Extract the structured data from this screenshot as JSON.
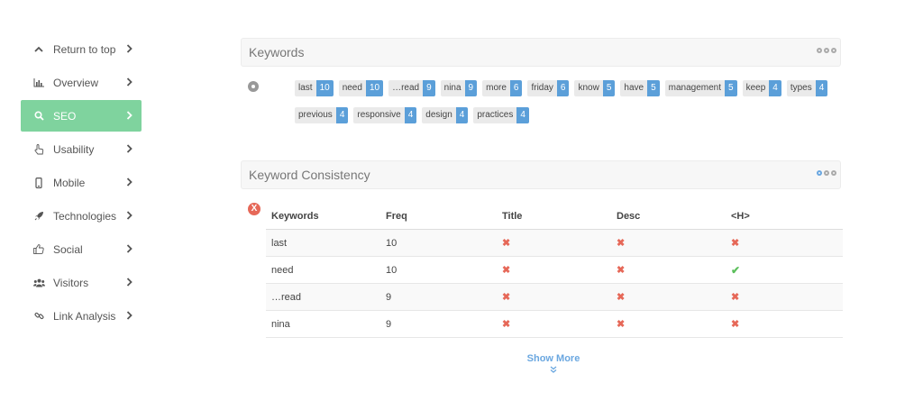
{
  "sidebar": {
    "items": [
      {
        "label": "Return to top",
        "icon": "chevron-up-icon"
      },
      {
        "label": "Overview",
        "icon": "bar-chart-icon"
      },
      {
        "label": "SEO",
        "icon": "search-icon",
        "active": true
      },
      {
        "label": "Usability",
        "icon": "pointer-hand-icon"
      },
      {
        "label": "Mobile",
        "icon": "mobile-icon"
      },
      {
        "label": "Technologies",
        "icon": "rocket-icon"
      },
      {
        "label": "Social",
        "icon": "thumbs-up-icon"
      },
      {
        "label": "Visitors",
        "icon": "users-icon"
      },
      {
        "label": "Link Analysis",
        "icon": "link-icon"
      }
    ],
    "active_color": "#7fd39e"
  },
  "keywords": {
    "title": "Keywords",
    "tags": [
      {
        "word": "last",
        "count": "10"
      },
      {
        "word": "need",
        "count": "10"
      },
      {
        "word": "…read",
        "count": "9"
      },
      {
        "word": "nina",
        "count": "9"
      },
      {
        "word": "more",
        "count": "6"
      },
      {
        "word": "friday",
        "count": "6"
      },
      {
        "word": "know",
        "count": "5"
      },
      {
        "word": "have",
        "count": "5"
      },
      {
        "word": "management",
        "count": "5"
      },
      {
        "word": "keep",
        "count": "4"
      },
      {
        "word": "types",
        "count": "4"
      },
      {
        "word": "previous",
        "count": "4"
      },
      {
        "word": "responsive",
        "count": "4"
      },
      {
        "word": "design",
        "count": "4"
      },
      {
        "word": "practices",
        "count": "4"
      }
    ],
    "count_color": "#5b9fd9"
  },
  "consistency": {
    "title": "Keyword Consistency",
    "badge": "X",
    "columns": [
      "Keywords",
      "Freq",
      "Title",
      "Desc",
      "<H>"
    ],
    "rows": [
      {
        "keyword": "last",
        "freq": "10",
        "title": false,
        "desc": false,
        "h": false
      },
      {
        "keyword": "need",
        "freq": "10",
        "title": false,
        "desc": false,
        "h": true
      },
      {
        "keyword": "…read",
        "freq": "9",
        "title": false,
        "desc": false,
        "h": false
      },
      {
        "keyword": "nina",
        "freq": "9",
        "title": false,
        "desc": false,
        "h": false
      }
    ],
    "show_more": "Show More",
    "error_color": "#e66858",
    "success_color": "#5cbf5c"
  }
}
